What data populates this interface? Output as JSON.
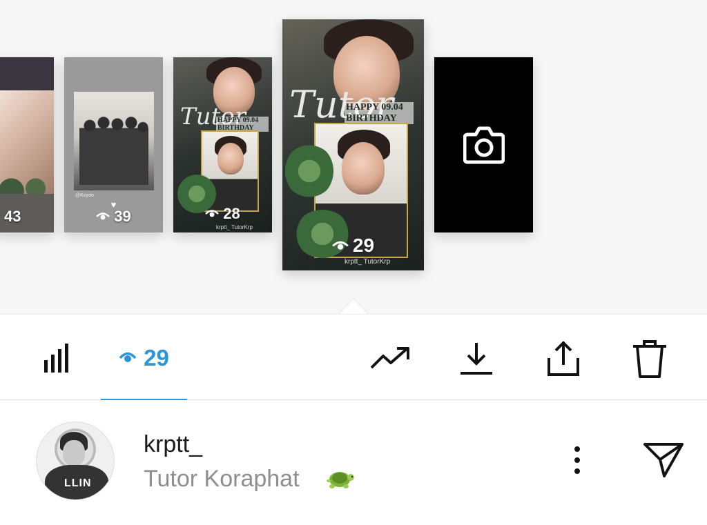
{
  "carousel": {
    "stories": [
      {
        "id": "story-1",
        "views": "43"
      },
      {
        "id": "story-2",
        "views": "39",
        "caption": "@Koydo"
      },
      {
        "id": "story-3",
        "views": "28",
        "poster_title": "Tutor",
        "poster_banner": "HAPPY 09.04 BIRTHDAY",
        "poster_credit": "krptt_  TutorKrp"
      },
      {
        "id": "story-4",
        "views": "29",
        "poster_title": "Tutor",
        "poster_banner": "HAPPY 09.04 BIRTHDAY",
        "poster_credit": "krptt_  TutorKrp"
      }
    ],
    "add_story_icon": "camera-icon"
  },
  "toolbar": {
    "insights_icon": "bar-chart-icon",
    "views_count": "29",
    "views_icon": "eye-icon",
    "actions": [
      "trending-icon",
      "download-icon",
      "share-icon",
      "trash-icon"
    ],
    "accent_color": "#2a95d8"
  },
  "viewer": {
    "username": "krptt_",
    "full_name": "Tutor Koraphat",
    "avatar_text": "LLIN",
    "emoji": "turtle",
    "menu_icon": "more-vertical-icon",
    "send_icon": "send-icon"
  }
}
